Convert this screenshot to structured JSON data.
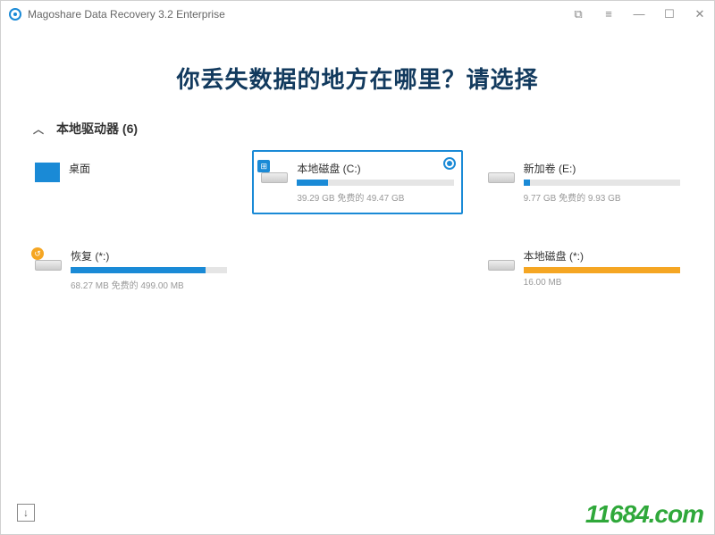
{
  "titlebar": {
    "title": "Magoshare Data Recovery 3.2 Enterprise"
  },
  "headline": "你丢失数据的地方在哪里？请选择",
  "section": {
    "label": "本地驱动器 (6)"
  },
  "drives": {
    "desktop": {
      "name": "桌面"
    },
    "c": {
      "name": "本地磁盘 (C:)",
      "stats": "39.29 GB 免费的 49.47 GB"
    },
    "e": {
      "name": "新加卷 (E:)",
      "stats": "9.77 GB 免费的 9.93 GB"
    },
    "recov": {
      "name": "恢复 (*:)",
      "stats": "68.27 MB 免费的 499.00 MB"
    },
    "star": {
      "name": "本地磁盘 (*:)",
      "stats": "16.00 MB"
    }
  },
  "watermark": "11684.com"
}
